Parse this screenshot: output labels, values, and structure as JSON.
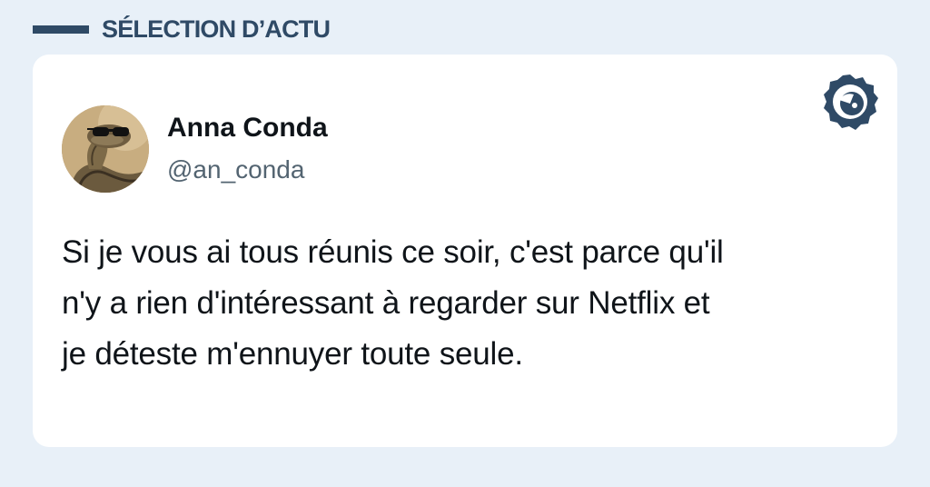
{
  "header": {
    "section_title": "SÉLECTION D’ACTU"
  },
  "tweet": {
    "author_name": "Anna Conda",
    "author_handle": "@an_conda",
    "text": "Si je vous ai tous réunis ce soir, c'est parce qu'il\nn'y a rien d'intéressant à regarder sur Netflix et\nje déteste m'ennuyer toute seule."
  },
  "icons": {
    "avatar": "snake-with-sunglasses-avatar",
    "brand_logo": "eye-logo-icon"
  },
  "colors": {
    "background": "#e8f0f8",
    "accent": "#2f4a66",
    "card": "#ffffff",
    "text": "#0f1419",
    "muted": "#536471"
  }
}
